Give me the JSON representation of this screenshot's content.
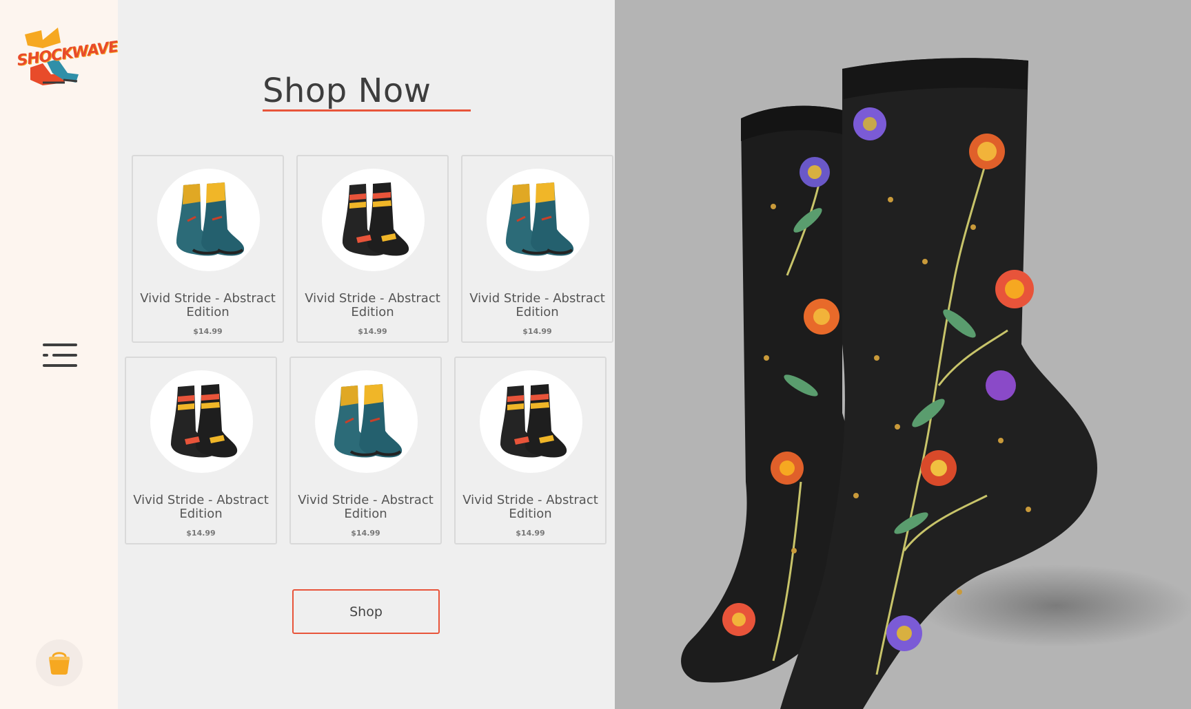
{
  "brand": {
    "name": "SHOCKWAVE"
  },
  "page": {
    "title": "Shop Now"
  },
  "products": [
    {
      "name": "Vivid Stride - Abstract Edition",
      "price": "$14.99",
      "variant": "teal-yellow"
    },
    {
      "name": "Vivid Stride - Abstract Edition",
      "price": "$14.99",
      "variant": "black-stripe"
    },
    {
      "name": "Vivid Stride - Abstract Edition",
      "price": "$14.99",
      "variant": "teal-yellow"
    },
    {
      "name": "Vivid Stride - Abstract Edition",
      "price": "$14.99",
      "variant": "black-stripe"
    },
    {
      "name": "Vivid Stride - Abstract Edition",
      "price": "$14.99",
      "variant": "teal-yellow"
    },
    {
      "name": "Vivid Stride - Abstract Edition",
      "price": "$14.99",
      "variant": "black-stripe"
    }
  ],
  "actions": {
    "shop_label": "Shop"
  },
  "icons": {
    "menu": "menu-icon",
    "cart": "shopping-basket-icon"
  },
  "colors": {
    "accent": "#e8543a",
    "sidebar_bg": "#fdf5ef",
    "main_bg": "#efefef",
    "hero_bg": "#b4b4b4"
  }
}
